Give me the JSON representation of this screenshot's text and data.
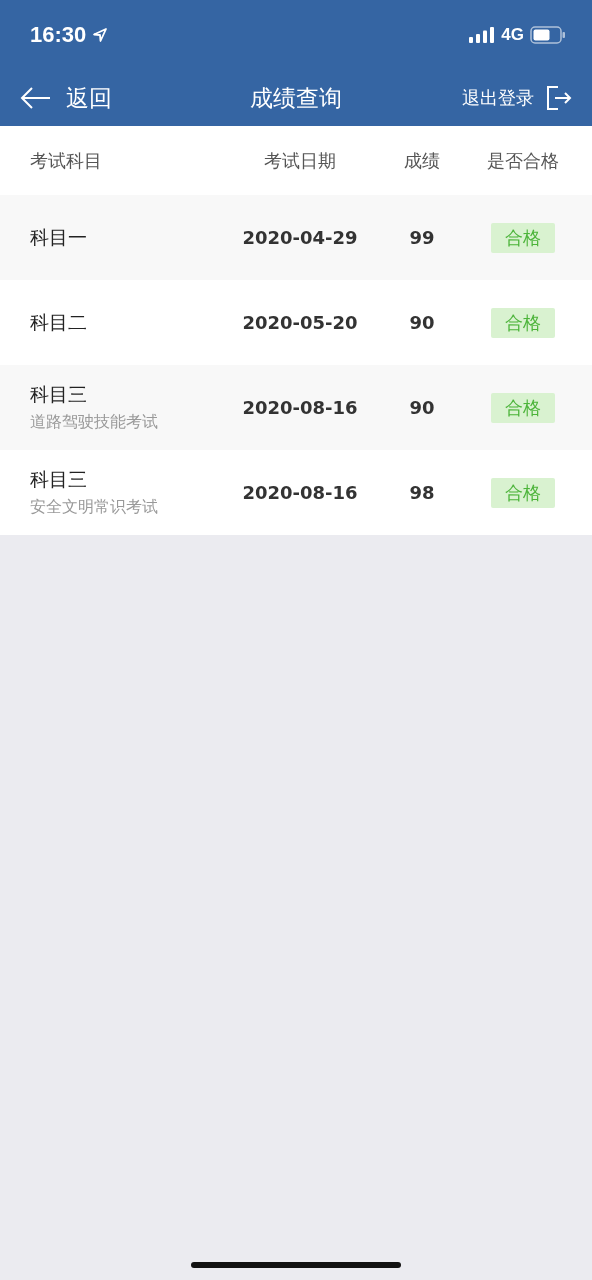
{
  "status_bar": {
    "time": "16:30",
    "network": "4G"
  },
  "nav": {
    "back": "返回",
    "title": "成绩查询",
    "logout": "退出登录"
  },
  "table": {
    "columns": [
      "考试科目",
      "考试日期",
      "成绩",
      "是否合格"
    ],
    "rows": [
      {
        "subject": "科目一",
        "date": "2020-04-29",
        "score": "99",
        "result": "合格",
        "passed": true
      },
      {
        "subject": "科目二",
        "date": "2020-05-20",
        "score": "90",
        "result": "合格",
        "passed": true
      },
      {
        "subject": "科目三",
        "note": "道路驾驶技能考试",
        "date": "2020-08-16",
        "score": "90",
        "result": "合格",
        "passed": true
      },
      {
        "subject": "科目三",
        "note": "安全文明常识考试",
        "date": "2020-08-16",
        "score": "98",
        "result": "合格",
        "passed": true
      }
    ]
  }
}
